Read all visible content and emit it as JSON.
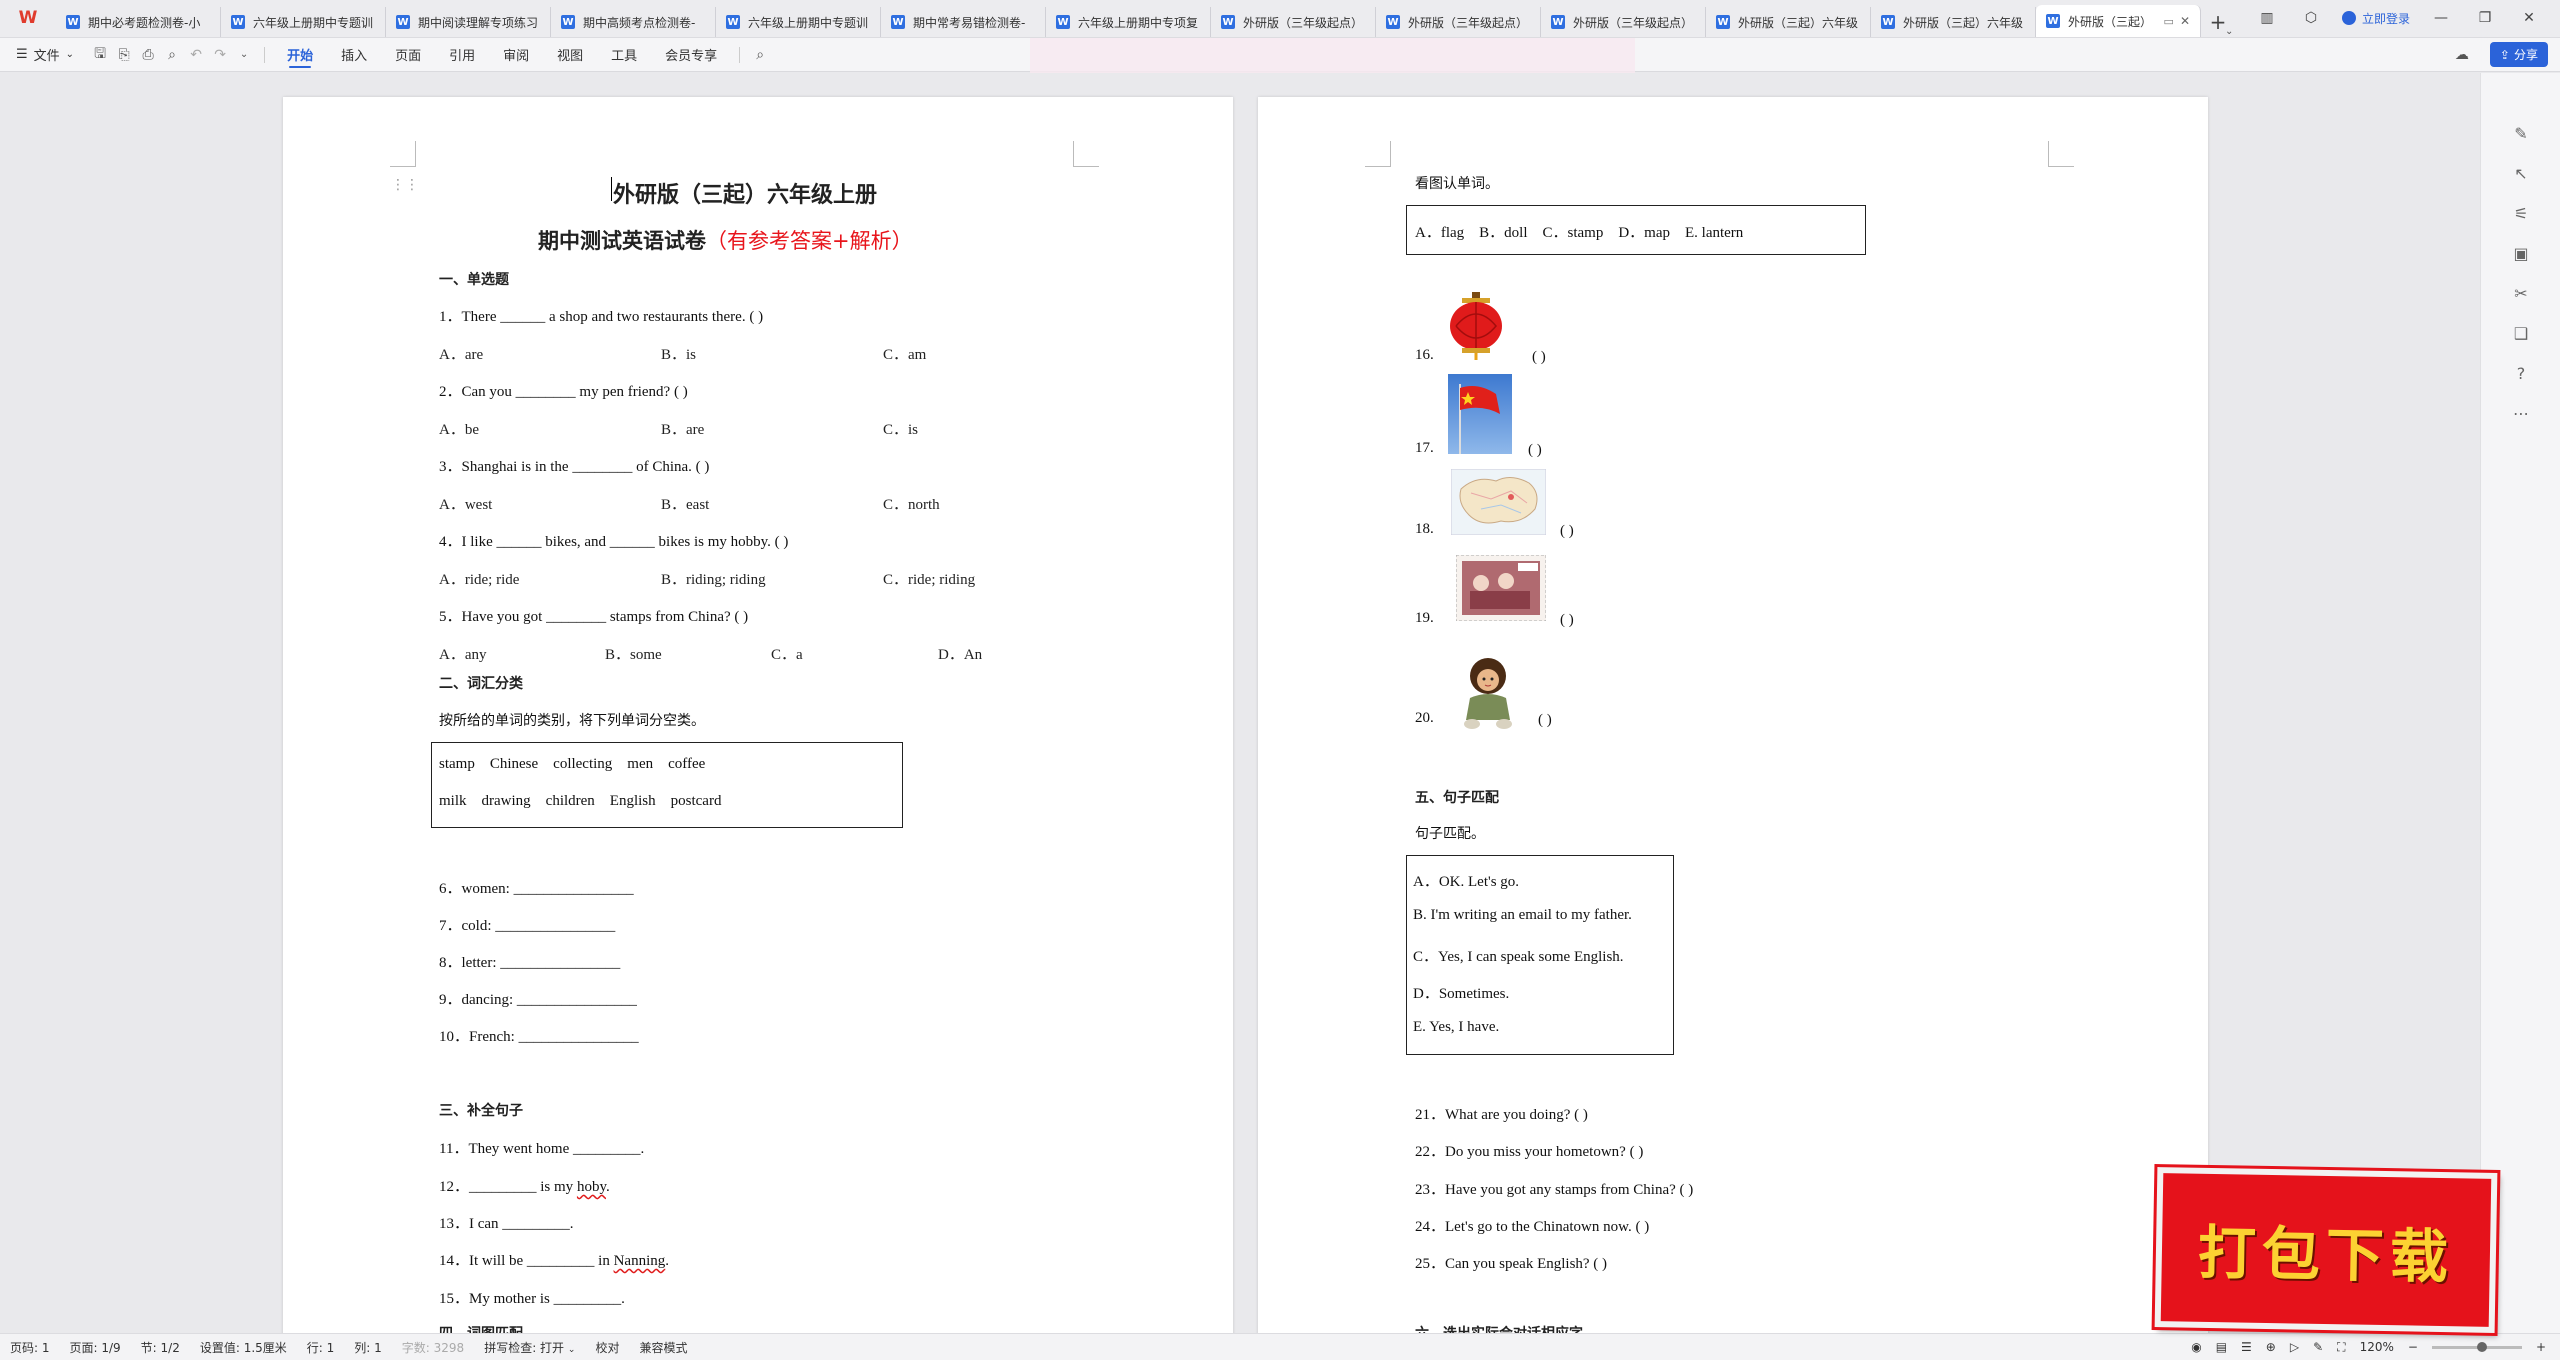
{
  "tabs": [
    {
      "label": "期中必考题检测卷-小",
      "active": false
    },
    {
      "label": "六年级上册期中专题训",
      "active": false
    },
    {
      "label": "期中阅读理解专项练习",
      "active": false
    },
    {
      "label": "期中高频考点检测卷-",
      "active": false
    },
    {
      "label": "六年级上册期中专题训",
      "active": false
    },
    {
      "label": "期中常考易错检测卷-",
      "active": false
    },
    {
      "label": "六年级上册期中专项复",
      "active": false
    },
    {
      "label": "外研版（三年级起点）",
      "active": false
    },
    {
      "label": "外研版（三年级起点）",
      "active": false
    },
    {
      "label": "外研版（三年级起点）",
      "active": false
    },
    {
      "label": "外研版（三起）六年级",
      "active": false
    },
    {
      "label": "外研版（三起）六年级",
      "active": false
    },
    {
      "label": "外研版（三起）",
      "active": true
    }
  ],
  "topbar": {
    "login": "立即登录",
    "share": "分享"
  },
  "ribbon": {
    "file": "文件",
    "menus": [
      "开始",
      "插入",
      "页面",
      "引用",
      "审阅",
      "视图",
      "工具",
      "会员专享"
    ],
    "active_menu": "开始"
  },
  "doc_left": {
    "title1": "外研版（三起）六年级上册",
    "title2_black": "期中测试英语试卷",
    "title2_red": "（有参考答案+解析）",
    "sec1": "一、单选题",
    "q1": "1．There ______ a shop and two restaurants there. (     )",
    "q1_opts": [
      "A．are",
      "B．is",
      "C．am"
    ],
    "q2": "2．Can you ________ my pen friend? (        )",
    "q2_opts": [
      "A．be",
      "B．are",
      "C．is"
    ],
    "q3": "3．Shanghai is in the ________ of China. (      )",
    "q3_opts": [
      "A．west",
      "B．east",
      "C．north"
    ],
    "q4": "4．I like ______ bikes, and ______ bikes is my hobby. (    )",
    "q4_opts": [
      "A．ride; ride",
      "B．riding; riding",
      "C．ride; riding"
    ],
    "q5": "5．Have you got ________ stamps from China? (    )",
    "q5_opts": [
      "A．any",
      "B．some",
      "C．a",
      "D．An"
    ],
    "sec2": "二、词汇分类",
    "sec2_instr": "按所给的单词的类别，将下列单词分空类。",
    "word_row1": "stamp    Chinese    collecting    men    coffee",
    "word_row2": "milk    drawing    children    English    postcard",
    "q6": "6．women: ________________",
    "q7": "7．cold: ________________",
    "q8": "8．letter: ________________",
    "q9": "9．dancing: ________________",
    "q10": "10．French: ________________",
    "sec3": "三、补全句子",
    "q11": "11．They went home _________.",
    "q12_pre": "12．_________ is my ",
    "q12_word": "hoby",
    "q12_post": ".",
    "q13": "13．I can _________.",
    "q14_pre": "14．It will be _________ in ",
    "q14_word": "Nanning",
    "q14_post": ".",
    "q15": "15．My mother is _________.",
    "sec4_partial": "四、词图匹配"
  },
  "doc_right": {
    "instr": "看图认单词。",
    "word_box": "A．flag    B．doll    C．stamp    D．map    E. lantern",
    "pic_items": [
      {
        "num": "16.",
        "icon": "lantern-icon",
        "paren": "(          )"
      },
      {
        "num": "17.",
        "icon": "flag-icon",
        "paren": "(          )"
      },
      {
        "num": "18.",
        "icon": "map-icon",
        "paren": "(          )"
      },
      {
        "num": "19.",
        "icon": "stamp-icon",
        "paren": "(          )"
      },
      {
        "num": "20.",
        "icon": "doll-icon",
        "paren": "(          )"
      }
    ],
    "sec5": "五、句子匹配",
    "sec5_instr": "句子匹配。",
    "match_opts": [
      "A．OK. Let's go.",
      "B. I'm writing an email to my father.",
      "C．Yes, I can speak some English.",
      "D．Sometimes.",
      "E. Yes, I have."
    ],
    "q21": "21．What are you doing? (           )",
    "q22": "22．Do you miss your hometown? (           )",
    "q23": "23．Have you got any stamps from China? (           )",
    "q24": "24．Let's go to the Chinatown now. (           )",
    "q25": "25．Can you speak English? (           )",
    "sec6_partial": "六、选出实际会对话相应字"
  },
  "status": {
    "page": "页码: 1",
    "pages": "页面: 1/9",
    "section": "节: 1/2",
    "setting": "设置值: 1.5厘米",
    "row": "行: 1",
    "col": "列: 1",
    "wordcount": "字数: 3298",
    "spell": "拼写检查: 打开",
    "proof": "校对",
    "compat": "兼容模式",
    "zoom": "120%"
  },
  "promo": {
    "text": "打包下载"
  },
  "colors": {
    "accent": "#2b63d9",
    "title_red": "#e8141b",
    "promo_red": "#e5121b",
    "promo_yellow": "#fcd232"
  }
}
